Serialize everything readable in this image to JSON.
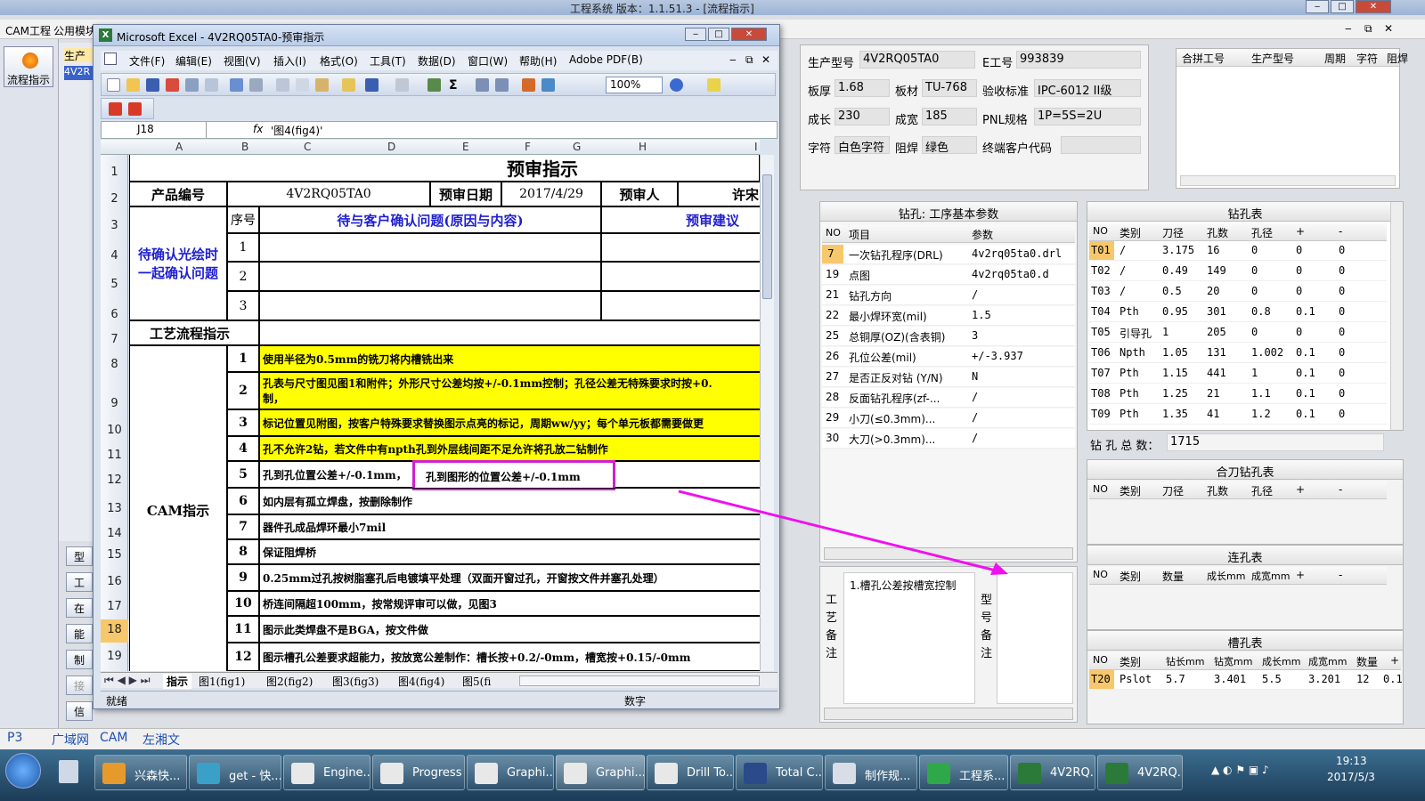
{
  "window": {
    "title": "工程系统   版本：1.1.51.3 - [流程指示]"
  },
  "app_menu": [
    "CAM工程",
    "公用模块"
  ],
  "left_nav": {
    "main_label": "流程指示",
    "side_buttons": [
      "型号",
      "工",
      "在",
      "能力",
      "制作",
      "接外",
      "信息"
    ]
  },
  "bg_left_panel": {
    "col": "生产",
    "val": "4V2R"
  },
  "excel": {
    "title": "Microsoft Excel - 4V2RQ05TA0-预审指示",
    "menu": [
      "文件(F)",
      "编辑(E)",
      "视图(V)",
      "插入(I)",
      "格式(O)",
      "工具(T)",
      "数据(D)",
      "窗口(W)",
      "帮助(H)",
      "Adobe PDF(B)"
    ],
    "zoom": "100%",
    "name_box": "J18",
    "fx": "fx",
    "formula": "'图4(fig4)'",
    "columns": [
      "A",
      "B",
      "C",
      "D",
      "E",
      "F",
      "G",
      "H",
      "I"
    ],
    "rows": [
      "1",
      "2",
      "3",
      "4",
      "5",
      "6",
      "7",
      "8",
      "9",
      "10",
      "11",
      "12",
      "13",
      "14",
      "15",
      "16",
      "17",
      "18",
      "19"
    ],
    "sheet": {
      "title": "预审指示",
      "product_label": "产品编号",
      "product_value": "4V2RQ05TA0",
      "date_label": "预审日期",
      "date_value": "2017/4/29",
      "reviewer_label": "预审人",
      "reviewer_value": "许宋",
      "seq_label": "序号",
      "issue_header": "待与客户确认问题(原因与内容)",
      "advice_header": "预审建议",
      "confirm_label": "待确认光绘时一起确认问题",
      "confirm_nums": [
        "1",
        "2",
        "3"
      ],
      "flow_label": "工艺流程指示",
      "cam_label": "CAM指示",
      "items": [
        {
          "n": "1",
          "t": "使用半径为0.5mm的铣刀将内槽铣出来"
        },
        {
          "n": "2",
          "t": "孔表与尺寸图见图1和附件；外形尺寸公差均按+/-0.1mm控制；孔径公差无特殊要求时按+0.",
          "t2": "制，"
        },
        {
          "n": "3",
          "t": "标记位置见附图，按客户特殊要求替换图示点亮的标记，周期ww/yy；每个单元板都需要做更"
        },
        {
          "n": "4",
          "t": "孔不允许2钻，若文件中有npth孔到外层线间距不足允许将孔放二钻制作"
        },
        {
          "n": "5",
          "t": "孔到孔位置公差+/-0.1mm，",
          "t2": "孔到图形的位置公差+/-0.1mm"
        },
        {
          "n": "6",
          "t": "如内层有孤立焊盘，按删除制作"
        },
        {
          "n": "7",
          "t": "器件孔成品焊环最小7mil"
        },
        {
          "n": "8",
          "t": "保证阻焊桥"
        },
        {
          "n": "9",
          "t": "0.25mm过孔按树脂塞孔后电镀填平处理（双面开窗过孔，开窗按文件并塞孔处理）"
        },
        {
          "n": "10",
          "t": "桥连间隔超100mm，按常规评审可以做，见图3"
        },
        {
          "n": "11",
          "t": "图示此类焊盘不是BGA，按文件做"
        },
        {
          "n": "12",
          "t": "图示槽孔公差要求超能力，按放宽公差制作：槽长按+0.2/-0mm，槽宽按+0.15/-0mm"
        }
      ]
    },
    "tabs": [
      "指示",
      "图1(fig1)",
      "图2(fig2)",
      "图3(fig3)",
      "图4(fig4)",
      "图5(fi"
    ],
    "status_left": "就绪",
    "status_right": "数字"
  },
  "info": {
    "product_model_label": "生产型号",
    "product_model": "4V2RQ05TA0",
    "eno_label": "E工号",
    "eno": "993839",
    "thick_label": "板厚",
    "thick": "1.68",
    "material_label": "板材",
    "material": "TU-768",
    "std_label": "验收标准",
    "std": "IPC-6012 II级",
    "len_label": "成长",
    "len": "230",
    "width_label": "成宽",
    "width": "185",
    "pnl_label": "PNL规格",
    "pnl": "1P=5S=2U",
    "char_label": "字符",
    "char": "白色字符",
    "mask_label": "阻焊",
    "mask": "绿色",
    "cust_label": "终端客户代码",
    "cust": ""
  },
  "merge_table": {
    "headers": [
      "合拼工号",
      "生产型号",
      "周期",
      "字符",
      "阻焊"
    ]
  },
  "drill_params": {
    "title": "钻孔: 工序基本参数",
    "headers": [
      "NO",
      "项目",
      "参数"
    ],
    "rows": [
      [
        "7",
        "一次钻孔程序(DRL)",
        "4v2rq05ta0.drl"
      ],
      [
        "19",
        "点图",
        "4v2rq05ta0.d"
      ],
      [
        "21",
        "钻孔方向",
        "/"
      ],
      [
        "22",
        "最小焊环宽(mil)",
        "1.5"
      ],
      [
        "25",
        "总铜厚(OZ)(含表铜)",
        "3"
      ],
      [
        "26",
        "孔位公差(mil)",
        "+/-3.937"
      ],
      [
        "27",
        "是否正反对钻 (Y/N)",
        "N"
      ],
      [
        "28",
        "反面钻孔程序(zf-...",
        "/"
      ],
      [
        "29",
        "小刀(≤0.3mm)...",
        "/"
      ],
      [
        "30",
        "大刀(>0.3mm)...",
        "/"
      ]
    ]
  },
  "drill_table": {
    "title": "钻孔表",
    "headers": [
      "NO",
      "类别",
      "刀径",
      "孔数",
      "孔径",
      "+",
      "-"
    ],
    "rows": [
      [
        "T01",
        "/",
        "3.175",
        "16",
        "0",
        "0",
        "0"
      ],
      [
        "T02",
        "/",
        "0.49",
        "149",
        "0",
        "0",
        "0"
      ],
      [
        "T03",
        "/",
        "0.5",
        "20",
        "0",
        "0",
        "0"
      ],
      [
        "T04",
        "Pth",
        "0.95",
        "301",
        "0.8",
        "0.1",
        "0"
      ],
      [
        "T05",
        "引导孔",
        "1",
        "205",
        "0",
        "0",
        "0"
      ],
      [
        "T06",
        "Npth",
        "1.05",
        "131",
        "1.002",
        "0.1",
        "0"
      ],
      [
        "T07",
        "Pth",
        "1.15",
        "441",
        "1",
        "0.1",
        "0"
      ],
      [
        "T08",
        "Pth",
        "1.25",
        "21",
        "1.1",
        "0.1",
        "0"
      ],
      [
        "T09",
        "Pth",
        "1.35",
        "41",
        "1.2",
        "0.1",
        "0"
      ]
    ],
    "total_label": "钻 孔 总 数：",
    "total": "1715"
  },
  "combined_drill": {
    "title": "合刀钻孔表",
    "headers": [
      "NO",
      "类别",
      "刀径",
      "孔数",
      "孔径",
      "+",
      "-"
    ]
  },
  "connect_table": {
    "title": "连孔表",
    "headers": [
      "NO",
      "类别",
      "数量",
      "成长mm",
      "成宽mm",
      "+",
      "-"
    ]
  },
  "slot_table": {
    "title": "槽孔表",
    "headers": [
      "NO",
      "类别",
      "钻长mm",
      "钻宽mm",
      "成长mm",
      "成宽mm",
      "数量",
      "+"
    ],
    "rows": [
      [
        "T20",
        "Pslot",
        "5.7",
        "3.401",
        "5.5",
        "3.201",
        "12",
        "0.1"
      ]
    ]
  },
  "notes": {
    "process_label": "工艺备注",
    "process_text": "1.槽孔公差按槽宽控制",
    "model_label": "型号备注"
  },
  "bottom_links": [
    "P3",
    "广域网",
    "CAM",
    "左湘文"
  ],
  "taskbar": {
    "items": [
      "兴森快...",
      "get - 快...",
      "Engine...",
      "Progress",
      "Graphi...",
      "Graphi...",
      "Drill To...",
      "Total C...",
      "制作规...",
      "工程系...",
      "4V2RQ...",
      "4V2RQ..."
    ],
    "time": "19:13",
    "date": "2017/5/3"
  },
  "colors": {
    "highlight_box": "#d020d0",
    "arrow": "#ee11ee",
    "yellow": "#ffff00",
    "blue_text": "#1f1fd0"
  }
}
